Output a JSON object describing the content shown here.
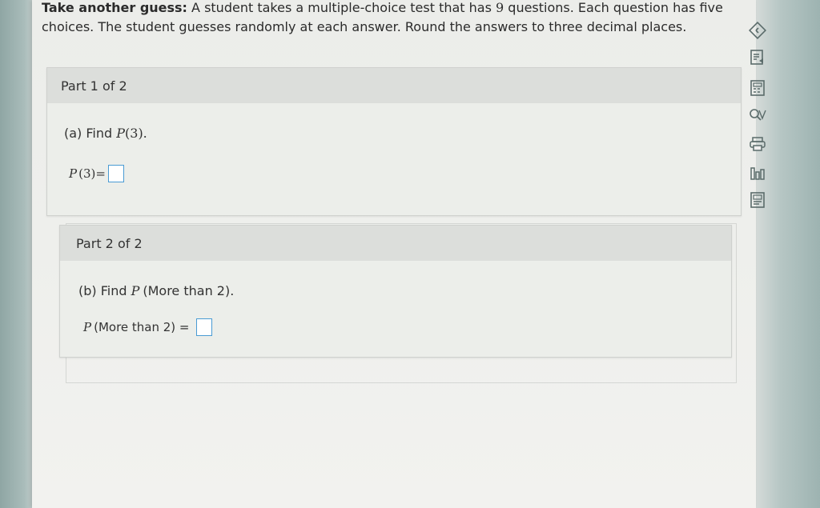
{
  "problem": {
    "bold_prefix": "Take another guess:",
    "text_before_n": " A student takes a multiple-choice test that has ",
    "n": "9",
    "text_after_n": " questions. Each question has five choices. The student guesses randomly at each answer. Round the answers to three decimal places."
  },
  "parts": [
    {
      "header": "Part 1 of 2",
      "question_label": "(a) Find ",
      "question_expr": "P",
      "question_arg": "(3).",
      "answer_label_var": "P",
      "answer_label_rest": "(3)="
    },
    {
      "header": "Part 2 of 2",
      "question_label": "(b) Find ",
      "question_expr": "P",
      "question_arg": "(More than 2).",
      "answer_label_var": "P",
      "answer_label_rest": "(More than 2) ="
    }
  ],
  "toolbar": {
    "icons": [
      "collapse-icon",
      "notes-icon",
      "calculator-icon",
      "glossary-icon",
      "print-icon",
      "data-icon",
      "textbook-icon"
    ]
  }
}
